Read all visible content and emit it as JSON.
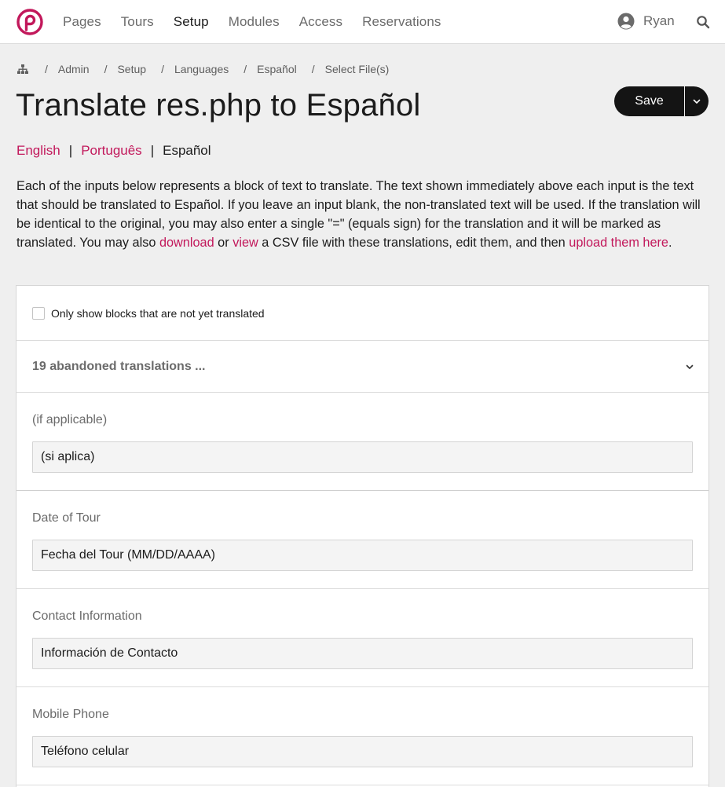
{
  "nav": {
    "items": [
      {
        "label": "Pages"
      },
      {
        "label": "Tours"
      },
      {
        "label": "Setup"
      },
      {
        "label": "Modules"
      },
      {
        "label": "Access"
      },
      {
        "label": "Reservations"
      }
    ],
    "active_index": 2,
    "user_name": "Ryan"
  },
  "breadcrumb": {
    "items": [
      {
        "label": "Admin"
      },
      {
        "label": "Setup"
      },
      {
        "label": "Languages"
      },
      {
        "label": "Español"
      }
    ],
    "current": "Select File(s)",
    "separator": "/"
  },
  "page": {
    "title": "Translate res.php to Español",
    "save_label": "Save"
  },
  "languages": {
    "links": [
      {
        "label": "English"
      },
      {
        "label": "Português"
      }
    ],
    "separator": "|",
    "current": "Español"
  },
  "intro": {
    "text1": "Each of the inputs below represents a block of text to translate. The text shown immediately above each input is the text that should be translated to Español. If you leave an input blank, the non-translated text will be used. If the translation will be identical to the original, you may also enter a single \"=\" (equals sign) for the translation and it will be marked as translated. You may also ",
    "link_download": "download",
    "text2": " or ",
    "link_view": "view",
    "text3": " a CSV file with these translations, edit them, and then ",
    "link_upload": "upload them here",
    "text4": "."
  },
  "filter": {
    "label": "Only show blocks that are not yet translated",
    "checked": false
  },
  "abandoned": {
    "label": "19 abandoned translations ..."
  },
  "blocks": [
    {
      "source": "(if applicable)",
      "value": "(si aplica)"
    },
    {
      "source": "Date of Tour",
      "value": "Fecha del Tour (MM/DD/AAAA)"
    },
    {
      "source": "Contact Information",
      "value": "Información de Contacto"
    },
    {
      "source": "Mobile Phone",
      "value": "Teléfono celular"
    }
  ],
  "colors": {
    "accent": "#c2185b",
    "button": "#141414",
    "background": "#efefef"
  }
}
